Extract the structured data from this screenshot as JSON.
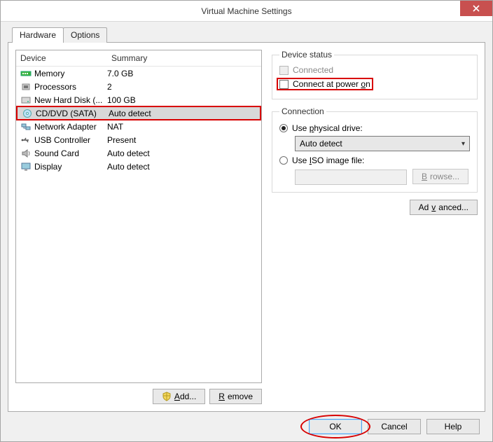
{
  "window": {
    "title": "Virtual Machine Settings"
  },
  "tabs": {
    "hardware": "Hardware",
    "options": "Options"
  },
  "columns": {
    "device": "Device",
    "summary": "Summary"
  },
  "devices": [
    {
      "name": "Memory",
      "summary": "7.0 GB",
      "icon": "memory"
    },
    {
      "name": "Processors",
      "summary": "2",
      "icon": "cpu"
    },
    {
      "name": "New Hard Disk (...",
      "summary": "100 GB",
      "icon": "hdd"
    },
    {
      "name": "CD/DVD (SATA)",
      "summary": "Auto detect",
      "icon": "cd",
      "selected": true,
      "highlight": true
    },
    {
      "name": "Network Adapter",
      "summary": "NAT",
      "icon": "net"
    },
    {
      "name": "USB Controller",
      "summary": "Present",
      "icon": "usb"
    },
    {
      "name": "Sound Card",
      "summary": "Auto detect",
      "icon": "sound"
    },
    {
      "name": "Display",
      "summary": "Auto detect",
      "icon": "display"
    }
  ],
  "leftButtons": {
    "add": "Add...",
    "remove": "Remove"
  },
  "deviceStatus": {
    "legend": "Device status",
    "connected": "Connected",
    "connectAtPowerOn": "Connect at power on"
  },
  "connection": {
    "legend": "Connection",
    "usePhysical_pre": "Use ",
    "usePhysical_u": "p",
    "usePhysical_post": "hysical drive:",
    "physicalValue": "Auto detect",
    "useIso_pre": "Use ",
    "useIso_u": "I",
    "useIso_post": "SO image file:",
    "browse_u": "B",
    "browse_post": "rowse...",
    "advanced_pre": "Ad",
    "advanced_u": "v",
    "advanced_post": "anced..."
  },
  "bottom": {
    "ok": "OK",
    "cancel": "Cancel",
    "help": "Help"
  }
}
